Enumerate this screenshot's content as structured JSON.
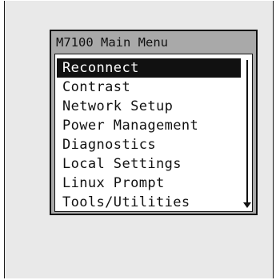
{
  "menu": {
    "title": "M7100 Main Menu",
    "selected_index": 0,
    "items": [
      {
        "label": "Reconnect"
      },
      {
        "label": "Contrast"
      },
      {
        "label": "Network Setup"
      },
      {
        "label": "Power Management"
      },
      {
        "label": "Diagnostics"
      },
      {
        "label": "Local Settings"
      },
      {
        "label": "Linux Prompt"
      },
      {
        "label": "Tools/Utilities"
      }
    ]
  },
  "icons": {
    "scroll_down": "down-arrow-icon"
  },
  "colors": {
    "screen_background": "#e9e9e9",
    "title_bar": "#a9a9a9",
    "panel": "#ffffff",
    "selection": "#111111",
    "text": "#111111"
  }
}
